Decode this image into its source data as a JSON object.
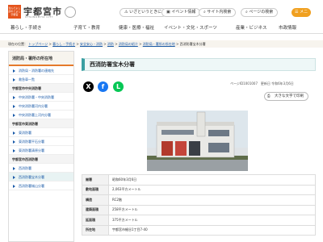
{
  "header": {
    "logo_badge": "住んでよし 訪れてよし 宇都宮",
    "logo_title": "宇都宮市",
    "logo_sub": "UTSUNOMIYA CITY",
    "emergency_btn": "いざというときに",
    "event_btn": "イベント情報",
    "procedure_btn": "サイト内検索",
    "page_search_btn": "ページの検索",
    "language_btn": "メニュー"
  },
  "global_nav": [
    "暮らし・手続き",
    "子育て・教育",
    "健康・医療・福祉",
    "イベント・文化・スポーツ",
    "産業・ビジネス",
    "市政情報"
  ],
  "breadcrumb": {
    "prefix": "現在の位置：",
    "links": [
      "トップページ",
      "暮らし・手続き",
      "安全安心・消防",
      "消防",
      "消防局の紹介",
      "消防局・署所の所在地"
    ],
    "current": "西消防署宝木分署"
  },
  "sidebar": {
    "title": "消防局・署所の所在地",
    "items": [
      {
        "type": "item",
        "label": "消防局・消防署の連絡先"
      },
      {
        "type": "item",
        "label": "救急車一覧"
      },
      {
        "type": "section",
        "label": "宇都宮市中央消防署"
      },
      {
        "type": "item",
        "label": "中央消防署・中央消防署"
      },
      {
        "type": "item",
        "label": "中央消防署河内分署"
      },
      {
        "type": "item",
        "label": "中央消防署上河内分署"
      },
      {
        "type": "section",
        "label": "宇都宮市東消防署"
      },
      {
        "type": "item",
        "label": "東消防署"
      },
      {
        "type": "item",
        "label": "東消防署平石分署"
      },
      {
        "type": "item",
        "label": "東消防署清原分署"
      },
      {
        "type": "section",
        "label": "宇都宮市西消防署"
      },
      {
        "type": "item",
        "label": "西消防署"
      },
      {
        "type": "item",
        "label": "西消防署宝木分署",
        "current": true
      },
      {
        "type": "item",
        "label": "西消防署城山分署"
      }
    ]
  },
  "page": {
    "title": "西消防署宝木分署",
    "page_id": "ページID1001007",
    "updated": "更新日 令和6年3月6日",
    "font_size_btn": "大きな文字で印刷"
  },
  "social": [
    {
      "name": "X",
      "color": "#000000",
      "glyph": "X"
    },
    {
      "name": "Facebook",
      "color": "#1877f2",
      "glyph": "f"
    },
    {
      "name": "LINE",
      "color": "#06c755",
      "glyph": "L"
    }
  ],
  "info_table": [
    {
      "key": "開署",
      "value": "昭和60年3月6日"
    },
    {
      "key": "敷地面積",
      "value": "2,063平方メートル"
    },
    {
      "key": "構造",
      "value": "RC2階"
    },
    {
      "key": "建築面積",
      "value": "258平方メートル"
    },
    {
      "key": "延面積",
      "value": "375平方メートル"
    },
    {
      "key": "所在地",
      "value": "宇都宮市細谷1丁目7-40"
    }
  ]
}
